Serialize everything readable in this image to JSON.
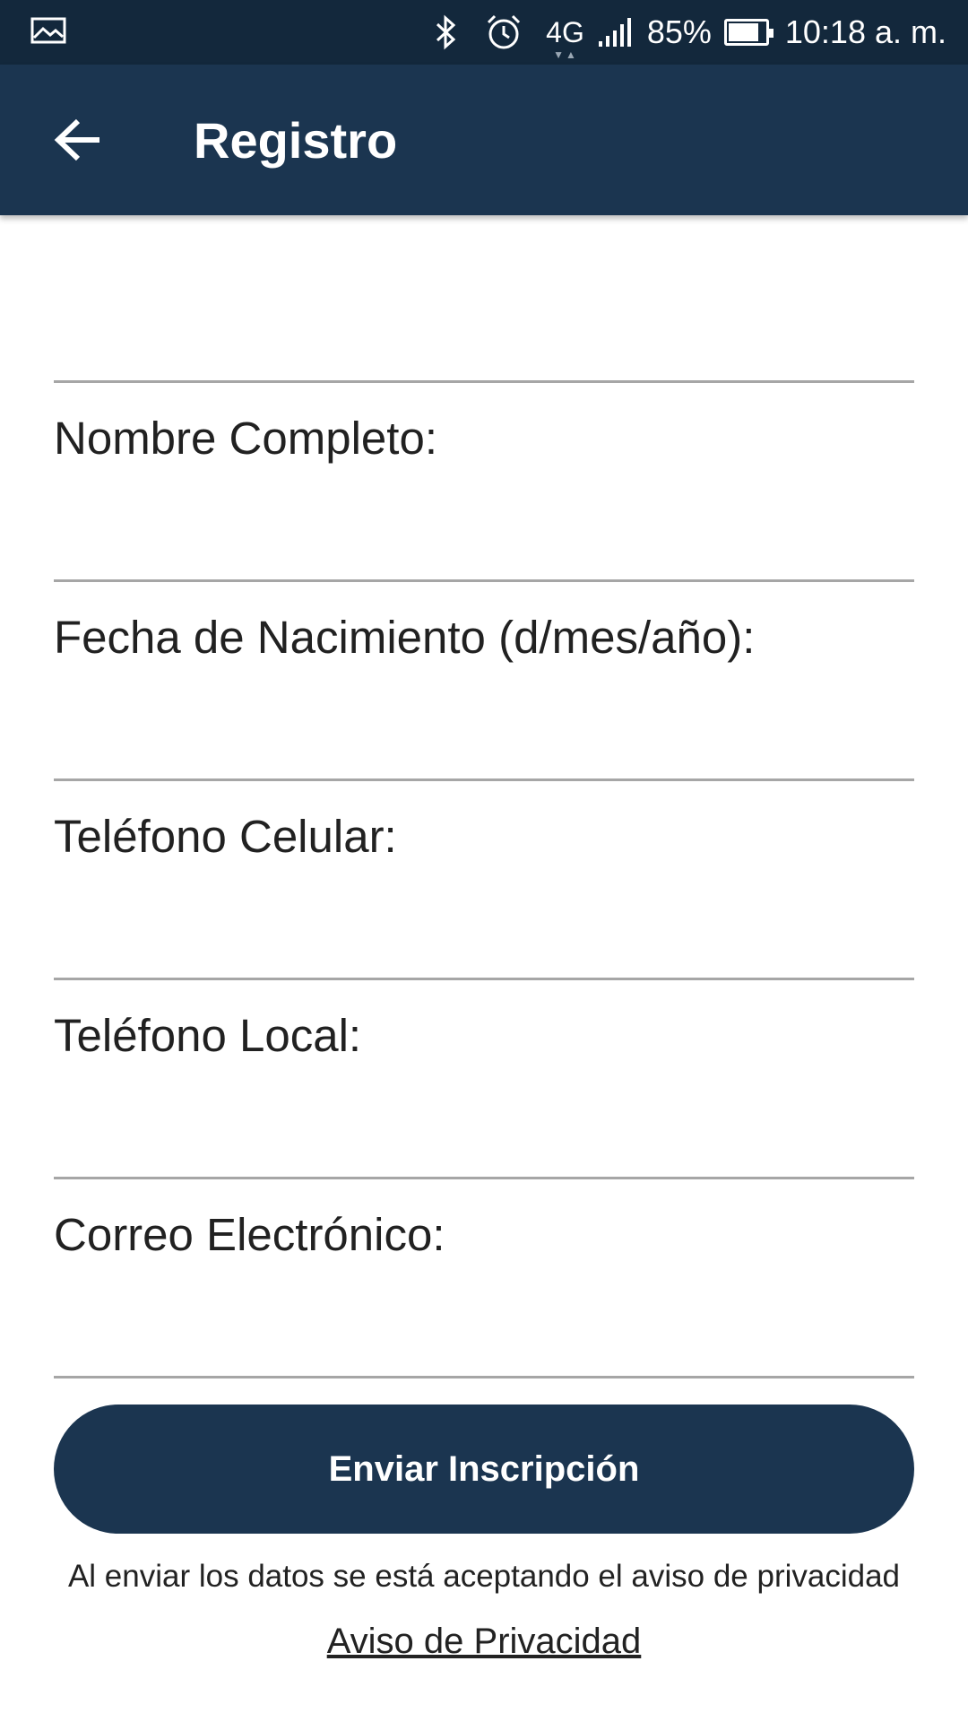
{
  "status_bar": {
    "network": "4G",
    "battery_percent": "85%",
    "battery_level": 0.85,
    "time": "10:18 a. m."
  },
  "app_bar": {
    "title": "Registro"
  },
  "form": {
    "fields": [
      {
        "label": "Nombre Completo:",
        "value": ""
      },
      {
        "label": "Fecha de Nacimiento (d/mes/año):",
        "value": ""
      },
      {
        "label": "Teléfono Celular:",
        "value": ""
      },
      {
        "label": "Teléfono Local:",
        "value": ""
      },
      {
        "label": "Correo Electrónico:",
        "value": ""
      }
    ]
  },
  "submit": {
    "label": "Enviar Inscripción"
  },
  "notice": "Al enviar los datos se está aceptando el aviso de privacidad",
  "privacy_link": "Aviso de Privacidad",
  "colors": {
    "status_bar": "#13283c",
    "app_bar": "#1b3550",
    "button": "#1b3550",
    "divider": "#a6a6a6"
  }
}
